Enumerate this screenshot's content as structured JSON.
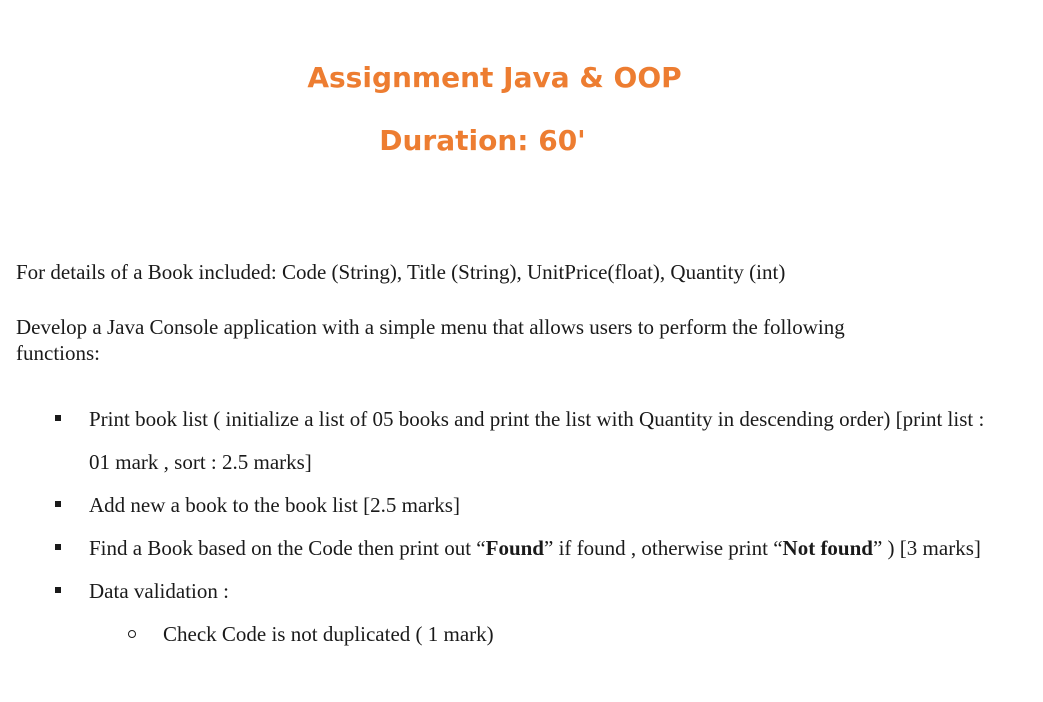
{
  "header": {
    "title": "Assignment Java & OOP",
    "duration": "Duration: 60'"
  },
  "body": {
    "intro": "For details of a Book included: Code (String), Title (String), UnitPrice(float), Quantity (int)",
    "develop": "Develop a Java Console application  with a simple menu that allows users to perform the following functions:"
  },
  "requirements": {
    "item1": "Print book list ( initialize a list of 05 books and print the list  with Quantity in descending order) [print list : 01 mark , sort : 2.5 marks]",
    "item2": "Add new a book to the book list [2.5 marks]",
    "item3_pre": "Find a Book based on the Code then print out “",
    "item3_found": "Found",
    "item3_mid": "” if found , otherwise print “",
    "item3_notfound": "Not found",
    "item3_post": "” )  [3 marks]",
    "item4": "Data validation :",
    "sub1": "Check Code is not duplicated ( 1 mark)"
  }
}
